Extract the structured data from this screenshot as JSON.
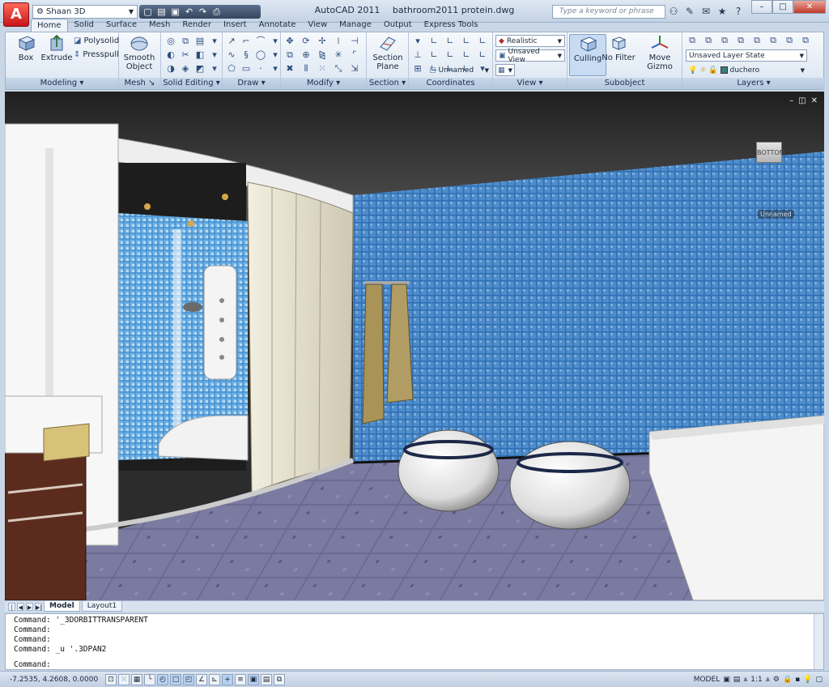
{
  "app": {
    "logo": "A",
    "name": "AutoCAD 2011",
    "document": "bathroom2011 protein.dwg"
  },
  "workspace": {
    "value": "Shaan 3D"
  },
  "quick_access": [
    "new-icon",
    "open-icon",
    "save-icon",
    "undo-icon",
    "redo-icon",
    "plot-icon"
  ],
  "search": {
    "placeholder": "Type a keyword or phrase"
  },
  "tabs": [
    "Home",
    "Solid",
    "Surface",
    "Mesh",
    "Render",
    "Insert",
    "Annotate",
    "View",
    "Manage",
    "Output",
    "Express Tools"
  ],
  "ribbon": {
    "modeling": {
      "title": "Modeling",
      "box": "Box",
      "extrude": "Extrude",
      "polysolid": "Polysolid",
      "presspull": "Presspull"
    },
    "mesh": {
      "title": "Mesh",
      "smooth": "Smooth",
      "object": "Object"
    },
    "solid_editing": {
      "title": "Solid Editing"
    },
    "draw": {
      "title": "Draw"
    },
    "modify": {
      "title": "Modify"
    },
    "section": {
      "title": "Section",
      "section": "Section",
      "plane": "Plane"
    },
    "coordinates": {
      "title": "Coordinates"
    },
    "view": {
      "title": "View",
      "visual_style": "Realistic",
      "saved_view": "Unsaved View",
      "named": "Unnamed"
    },
    "subobject": {
      "title": "Subobject",
      "culling": "Culling",
      "no_filter": "No Filter",
      "move_gizmo": "Move Gizmo"
    },
    "layers": {
      "title": "Layers",
      "layer_state": "Unsaved Layer State",
      "current_layer": "duchero"
    }
  },
  "viewport": {
    "viewcube_label": "BOTTOM",
    "wcs_label": "Unnamed",
    "colors": {
      "ceiling": "#2b2b2b",
      "wall_tile": "#2f6fb3",
      "floor_tile": "#6a6a8f",
      "cabinet": "#5b2c1e"
    }
  },
  "layout_tabs": [
    "Model",
    "Layout1"
  ],
  "command_line": {
    "history": [
      "Command: '_3DORBITTRANSPARENT",
      "Command:",
      "Command:",
      "Command: _u '.3DPAN2"
    ],
    "prompt": "Command:"
  },
  "status": {
    "coordinates": "-7.2535, 4.2608, 0.0000",
    "model": "MODEL",
    "annotation_scale": "1:1"
  }
}
